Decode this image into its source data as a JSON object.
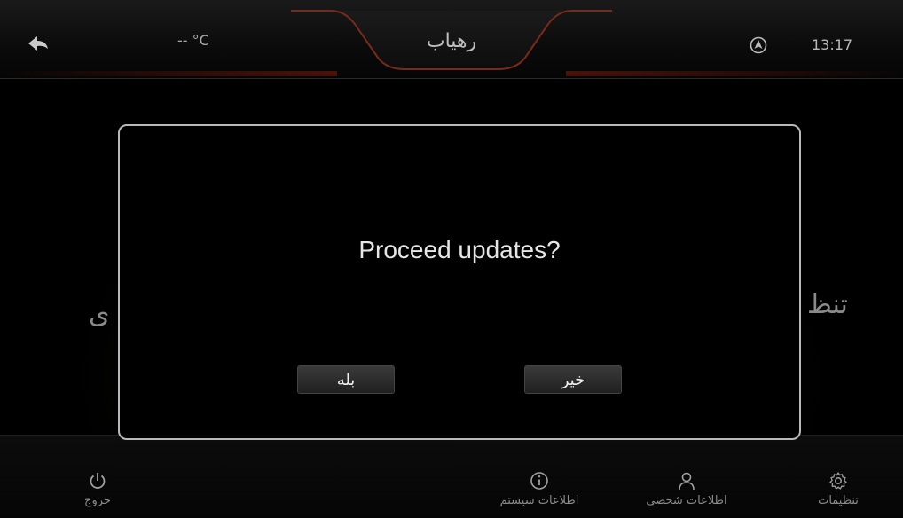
{
  "header": {
    "title": "رهیاب",
    "temperature": "-- °C",
    "time": "13:17"
  },
  "background": {
    "left_label": "ی",
    "right_label": "تنظ"
  },
  "dialog": {
    "message": "Proceed updates?",
    "yes_label": "بله",
    "no_label": "خیر"
  },
  "bottom_nav": {
    "exit_label": "خروج",
    "system_info_label": "اطلاعات  سیستم",
    "personal_info_label": "اطلاعات  شخصی",
    "settings_label": "تنظیمات"
  },
  "colors": {
    "accent_glow": "#c82814",
    "dialog_border": "#b9b9b9"
  }
}
